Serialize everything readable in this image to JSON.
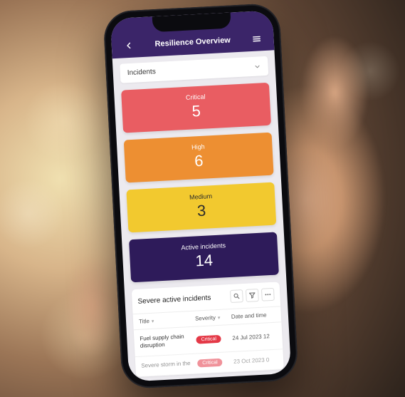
{
  "header": {
    "title": "Resilience Overview"
  },
  "selector": {
    "label": "Incidents"
  },
  "tiles": {
    "critical": {
      "label": "Critical",
      "value": "5"
    },
    "high": {
      "label": "High",
      "value": "6"
    },
    "medium": {
      "label": "Medium",
      "value": "3"
    },
    "active": {
      "label": "Active incidents",
      "value": "14"
    }
  },
  "list": {
    "heading": "Severe active incidents",
    "columns": {
      "title": "Title",
      "severity": "Severity",
      "date": "Date and time"
    },
    "rows": [
      {
        "title": "Fuel supply chain disruption",
        "severity": "Critical",
        "date": "24 Jul 2023 12"
      },
      {
        "title": "Severe storm in the",
        "severity": "Critical",
        "date": "23 Oct 2023 0"
      }
    ]
  },
  "colors": {
    "brand": "#3b2569",
    "critical": "#e95d62",
    "high": "#ed8f32",
    "medium": "#f2c92f",
    "active": "#2e1b5a",
    "badge": "#e43947"
  }
}
